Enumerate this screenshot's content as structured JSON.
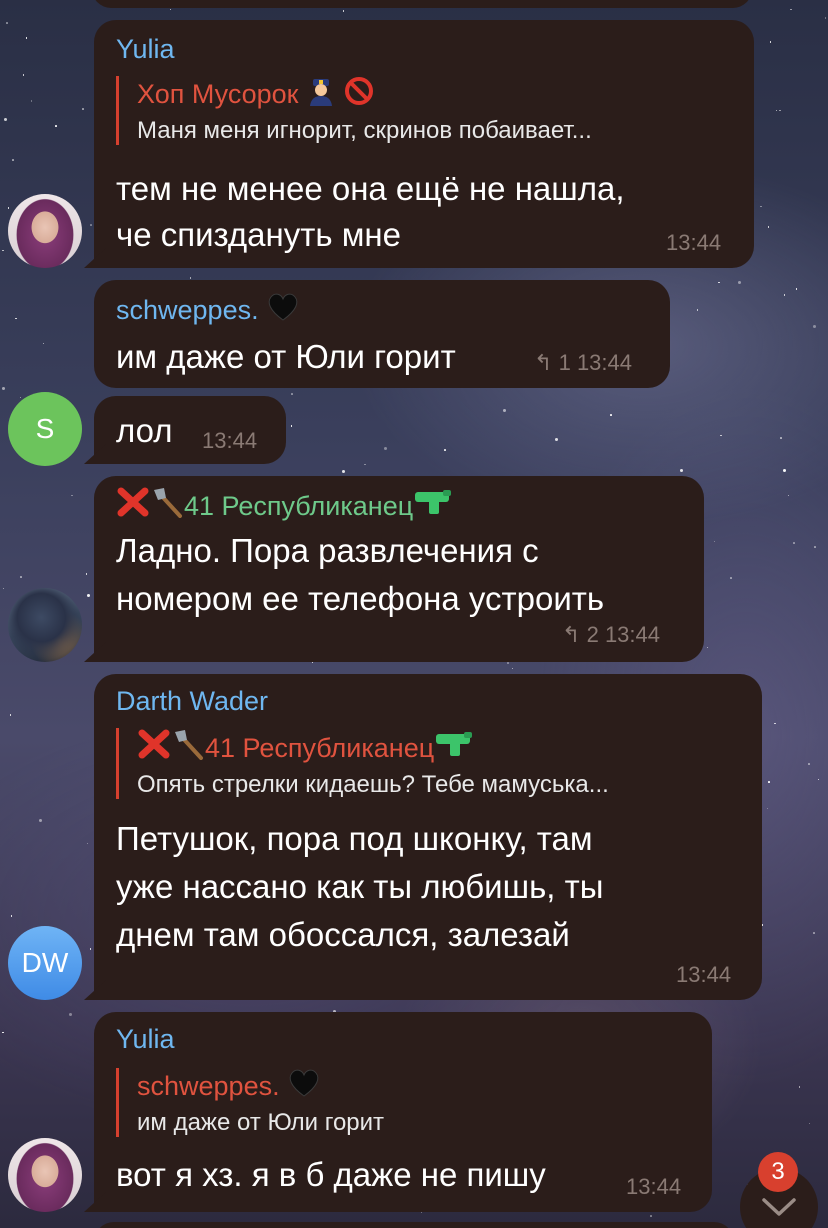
{
  "messages": [
    {
      "sender": "Yulia",
      "reply_to": {
        "name": "Хоп Мусорок",
        "text": "Маня меня игнорит, скринов побаивает..."
      },
      "lines": [
        "тем не менее она ещё не нашла,",
        "че спиздануть мне"
      ],
      "time": "13:44",
      "avatar": "yulia-photo"
    },
    {
      "sender": "schweppes.",
      "lines": [
        "им даже от Юли горит"
      ],
      "replies": "1",
      "time": "13:44"
    },
    {
      "lines": [
        "лол"
      ],
      "time": "13:44",
      "avatar_initial": "S"
    },
    {
      "sender": "41 Республиканец",
      "lines": [
        "Ладно. Пора развлечения с",
        "номером ее телефона устроить"
      ],
      "replies": "2",
      "time": "13:44",
      "avatar": "republican-photo"
    },
    {
      "sender": "Darth Wader",
      "reply_to": {
        "name": "41 Республиканец",
        "text": "Опять стрелки кидаешь? Тебе мамуська..."
      },
      "lines": [
        "Петушок, пора под шконку, там",
        "уже нассано как ты любишь, ты",
        "днем там обоссался, залезай"
      ],
      "time": "13:44",
      "avatar_initial": "DW"
    },
    {
      "sender": "Yulia",
      "reply_to": {
        "name": "schweppes.",
        "text": "им даже от Юли горит"
      },
      "lines": [
        "вот я хз. я в б даже не пишу"
      ],
      "time": "13:44",
      "avatar": "yulia-photo"
    }
  ],
  "scroll_down": {
    "unread_count": "3",
    "icon": "chevron-down-icon"
  },
  "colors": {
    "bubble": "#2b1d1a",
    "sender_blue": "#6fb7f0",
    "reply_red": "#e0533f",
    "meta": "#8a7a74",
    "badge": "#d8402e"
  }
}
